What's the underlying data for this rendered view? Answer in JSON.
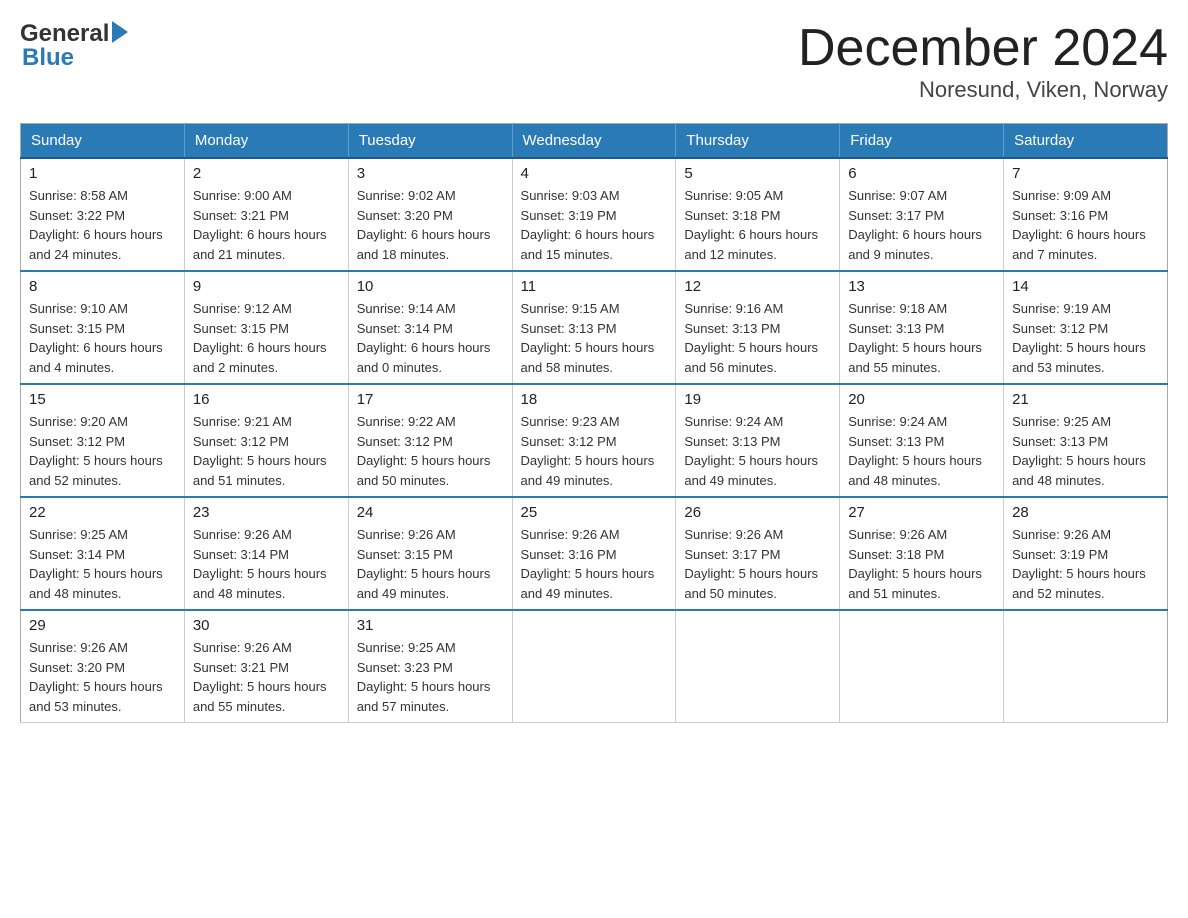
{
  "header": {
    "logo_general": "General",
    "logo_blue": "Blue",
    "month_title": "December 2024",
    "location": "Noresund, Viken, Norway"
  },
  "weekdays": [
    "Sunday",
    "Monday",
    "Tuesday",
    "Wednesday",
    "Thursday",
    "Friday",
    "Saturday"
  ],
  "weeks": [
    [
      {
        "day": "1",
        "sunrise": "8:58 AM",
        "sunset": "3:22 PM",
        "daylight": "6 hours and 24 minutes."
      },
      {
        "day": "2",
        "sunrise": "9:00 AM",
        "sunset": "3:21 PM",
        "daylight": "6 hours and 21 minutes."
      },
      {
        "day": "3",
        "sunrise": "9:02 AM",
        "sunset": "3:20 PM",
        "daylight": "6 hours and 18 minutes."
      },
      {
        "day": "4",
        "sunrise": "9:03 AM",
        "sunset": "3:19 PM",
        "daylight": "6 hours and 15 minutes."
      },
      {
        "day": "5",
        "sunrise": "9:05 AM",
        "sunset": "3:18 PM",
        "daylight": "6 hours and 12 minutes."
      },
      {
        "day": "6",
        "sunrise": "9:07 AM",
        "sunset": "3:17 PM",
        "daylight": "6 hours and 9 minutes."
      },
      {
        "day": "7",
        "sunrise": "9:09 AM",
        "sunset": "3:16 PM",
        "daylight": "6 hours and 7 minutes."
      }
    ],
    [
      {
        "day": "8",
        "sunrise": "9:10 AM",
        "sunset": "3:15 PM",
        "daylight": "6 hours and 4 minutes."
      },
      {
        "day": "9",
        "sunrise": "9:12 AM",
        "sunset": "3:15 PM",
        "daylight": "6 hours and 2 minutes."
      },
      {
        "day": "10",
        "sunrise": "9:14 AM",
        "sunset": "3:14 PM",
        "daylight": "6 hours and 0 minutes."
      },
      {
        "day": "11",
        "sunrise": "9:15 AM",
        "sunset": "3:13 PM",
        "daylight": "5 hours and 58 minutes."
      },
      {
        "day": "12",
        "sunrise": "9:16 AM",
        "sunset": "3:13 PM",
        "daylight": "5 hours and 56 minutes."
      },
      {
        "day": "13",
        "sunrise": "9:18 AM",
        "sunset": "3:13 PM",
        "daylight": "5 hours and 55 minutes."
      },
      {
        "day": "14",
        "sunrise": "9:19 AM",
        "sunset": "3:12 PM",
        "daylight": "5 hours and 53 minutes."
      }
    ],
    [
      {
        "day": "15",
        "sunrise": "9:20 AM",
        "sunset": "3:12 PM",
        "daylight": "5 hours and 52 minutes."
      },
      {
        "day": "16",
        "sunrise": "9:21 AM",
        "sunset": "3:12 PM",
        "daylight": "5 hours and 51 minutes."
      },
      {
        "day": "17",
        "sunrise": "9:22 AM",
        "sunset": "3:12 PM",
        "daylight": "5 hours and 50 minutes."
      },
      {
        "day": "18",
        "sunrise": "9:23 AM",
        "sunset": "3:12 PM",
        "daylight": "5 hours and 49 minutes."
      },
      {
        "day": "19",
        "sunrise": "9:24 AM",
        "sunset": "3:13 PM",
        "daylight": "5 hours and 49 minutes."
      },
      {
        "day": "20",
        "sunrise": "9:24 AM",
        "sunset": "3:13 PM",
        "daylight": "5 hours and 48 minutes."
      },
      {
        "day": "21",
        "sunrise": "9:25 AM",
        "sunset": "3:13 PM",
        "daylight": "5 hours and 48 minutes."
      }
    ],
    [
      {
        "day": "22",
        "sunrise": "9:25 AM",
        "sunset": "3:14 PM",
        "daylight": "5 hours and 48 minutes."
      },
      {
        "day": "23",
        "sunrise": "9:26 AM",
        "sunset": "3:14 PM",
        "daylight": "5 hours and 48 minutes."
      },
      {
        "day": "24",
        "sunrise": "9:26 AM",
        "sunset": "3:15 PM",
        "daylight": "5 hours and 49 minutes."
      },
      {
        "day": "25",
        "sunrise": "9:26 AM",
        "sunset": "3:16 PM",
        "daylight": "5 hours and 49 minutes."
      },
      {
        "day": "26",
        "sunrise": "9:26 AM",
        "sunset": "3:17 PM",
        "daylight": "5 hours and 50 minutes."
      },
      {
        "day": "27",
        "sunrise": "9:26 AM",
        "sunset": "3:18 PM",
        "daylight": "5 hours and 51 minutes."
      },
      {
        "day": "28",
        "sunrise": "9:26 AM",
        "sunset": "3:19 PM",
        "daylight": "5 hours and 52 minutes."
      }
    ],
    [
      {
        "day": "29",
        "sunrise": "9:26 AM",
        "sunset": "3:20 PM",
        "daylight": "5 hours and 53 minutes."
      },
      {
        "day": "30",
        "sunrise": "9:26 AM",
        "sunset": "3:21 PM",
        "daylight": "5 hours and 55 minutes."
      },
      {
        "day": "31",
        "sunrise": "9:25 AM",
        "sunset": "3:23 PM",
        "daylight": "5 hours and 57 minutes."
      },
      null,
      null,
      null,
      null
    ]
  ],
  "labels": {
    "sunrise": "Sunrise:",
    "sunset": "Sunset:",
    "daylight": "Daylight:"
  }
}
